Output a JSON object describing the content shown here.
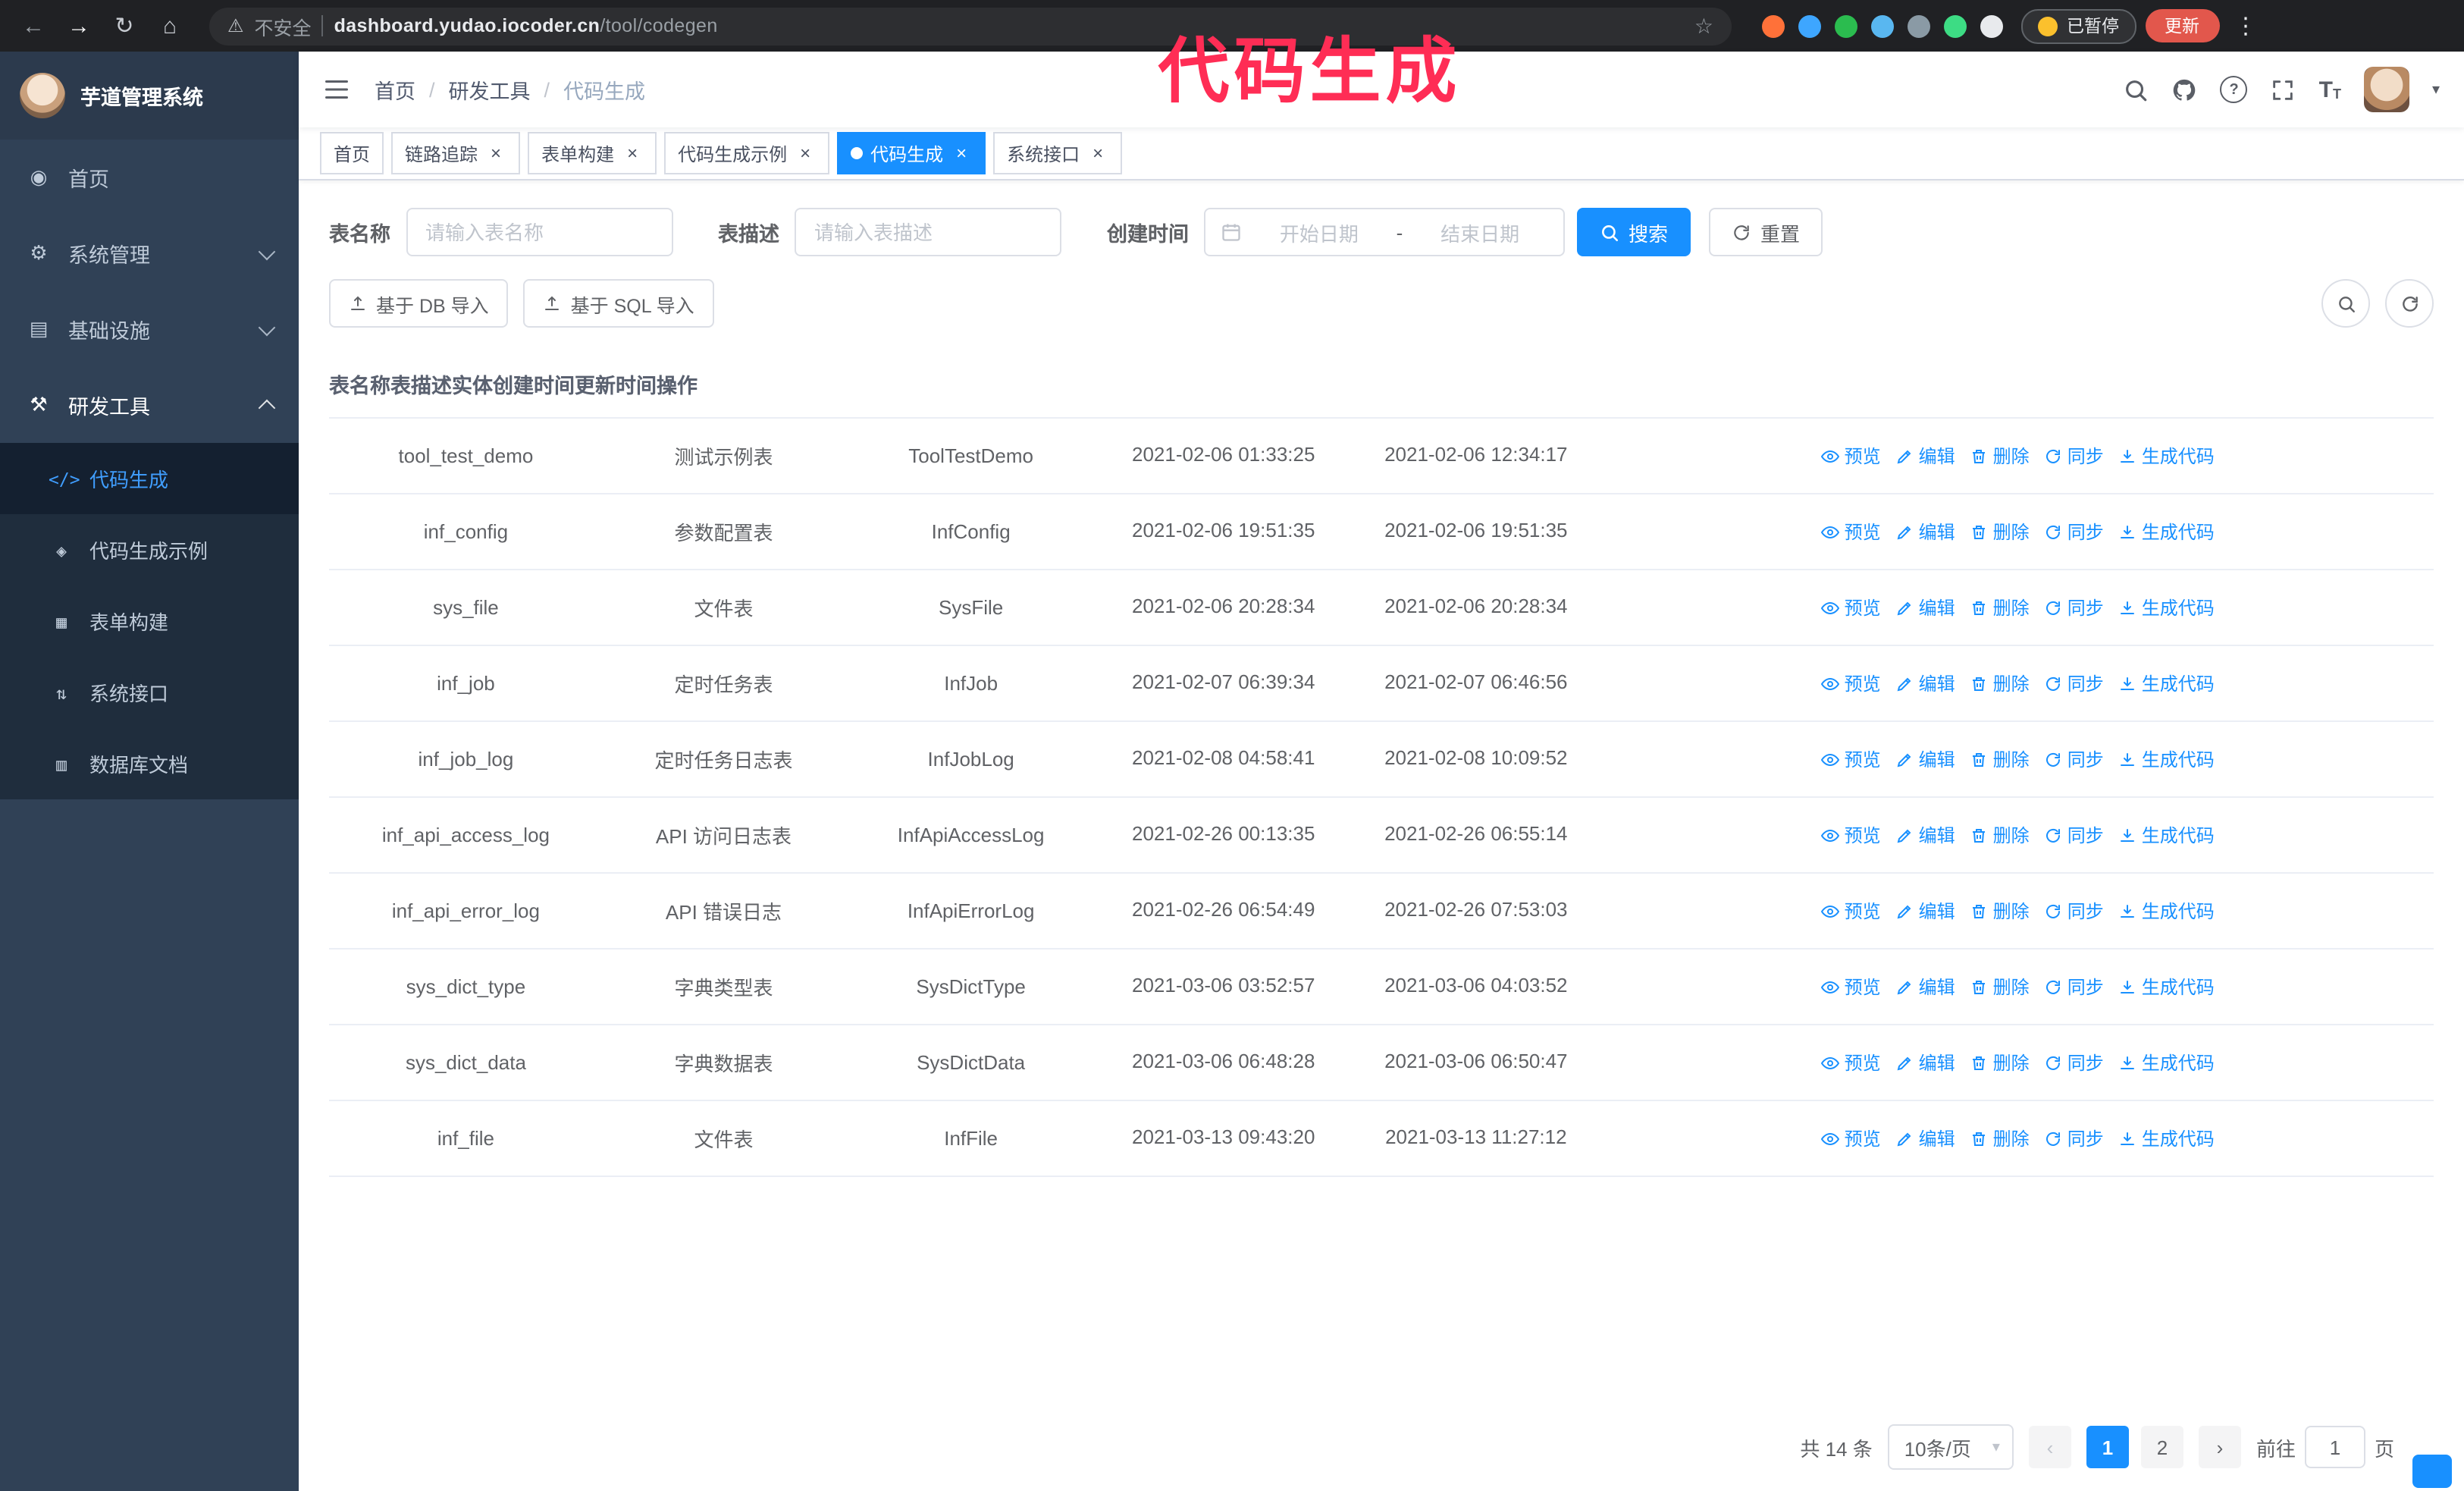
{
  "colors": {
    "primary": "#1890ff",
    "annotation": "#ff2d55",
    "sidebar_bg": "#304156"
  },
  "icons": {
    "back": "←",
    "forward": "→",
    "reload": "↻",
    "home": "⌂",
    "warning": "⚠",
    "star": "☆",
    "dots": "⋮",
    "close": "×",
    "prev": "‹",
    "next": "›",
    "caret": "▾",
    "question": "?",
    "fontsize_large": "T",
    "fontsize_small": "T"
  },
  "browser": {
    "security_label": "不安全",
    "url_host": "dashboard.yudao.iocoder.cn",
    "url_path": "/tool/codegen",
    "paused_badge": "已暂停",
    "update_button": "更新",
    "extensions": [
      {
        "color": "#ff7139"
      },
      {
        "color": "#3ea6ff"
      },
      {
        "color": "#2bbc4f"
      },
      {
        "color": "#59b7f0"
      },
      {
        "color": "#8a9aa5"
      },
      {
        "color": "#3ddc84"
      },
      {
        "color": "#e8eaed"
      }
    ]
  },
  "annotation": {
    "text": "代码生成"
  },
  "sidebar": {
    "logo_title": "芋道管理系统",
    "items": [
      {
        "label": "首页",
        "icon": "dashboard-icon",
        "glyph": "◉"
      },
      {
        "label": "系统管理",
        "icon": "system-icon",
        "glyph": "⚙",
        "chevron_down": true
      },
      {
        "label": "基础设施",
        "icon": "infra-icon",
        "glyph": "▤",
        "chevron_down": true
      },
      {
        "label": "研发工具",
        "icon": "tools-icon",
        "glyph": "⚒",
        "chevron_up": true,
        "expanded": true
      }
    ],
    "subitems": [
      {
        "label": "代码生成",
        "icon": "code-icon",
        "glyph": "</>",
        "active": true
      },
      {
        "label": "代码生成示例",
        "icon": "example-icon",
        "glyph": "◈"
      },
      {
        "label": "表单构建",
        "icon": "form-icon",
        "glyph": "▦"
      },
      {
        "label": "系统接口",
        "icon": "api-icon",
        "glyph": "⇅"
      },
      {
        "label": "数据库文档",
        "icon": "db-doc-icon",
        "glyph": "▥"
      }
    ]
  },
  "header": {
    "breadcrumb": [
      {
        "label": "首页"
      },
      {
        "label": "研发工具"
      },
      {
        "label": "代码生成"
      }
    ],
    "breadcrumb_separator": "/"
  },
  "tabs": [
    {
      "label": "首页",
      "closable": false,
      "active": false
    },
    {
      "label": "链路追踪",
      "closable": true,
      "active": false
    },
    {
      "label": "表单构建",
      "closable": true,
      "active": false
    },
    {
      "label": "代码生成示例",
      "closable": true,
      "active": false
    },
    {
      "label": "代码生成",
      "closable": true,
      "active": true
    },
    {
      "label": "系统接口",
      "closable": true,
      "active": false
    }
  ],
  "filters": {
    "table_name_label": "表名称",
    "table_name_placeholder": "请输入表名称",
    "table_desc_label": "表描述",
    "table_desc_placeholder": "请输入表描述",
    "create_time_label": "创建时间",
    "date_start_placeholder": "开始日期",
    "date_separator": "-",
    "date_end_placeholder": "结束日期",
    "search_button": "搜索",
    "reset_button": "重置"
  },
  "toolbar": {
    "import_db": "基于 DB 导入",
    "import_sql": "基于 SQL 导入"
  },
  "table": {
    "columns": [
      "表名称",
      "表描述",
      "实体",
      "创建时间",
      "更新时间",
      "操作"
    ],
    "actions": [
      "预览",
      "编辑",
      "删除",
      "同步",
      "生成代码"
    ],
    "rows": [
      {
        "name": "tool_test_demo",
        "desc": "测试示例表",
        "entity": "ToolTestDemo",
        "created": "2021-02-06 01:33:25",
        "updated": "2021-02-06 12:34:17"
      },
      {
        "name": "inf_config",
        "desc": "参数配置表",
        "entity": "InfConfig",
        "created": "2021-02-06 19:51:35",
        "updated": "2021-02-06 19:51:35"
      },
      {
        "name": "sys_file",
        "desc": "文件表",
        "entity": "SysFile",
        "created": "2021-02-06 20:28:34",
        "updated": "2021-02-06 20:28:34"
      },
      {
        "name": "inf_job",
        "desc": "定时任务表",
        "entity": "InfJob",
        "created": "2021-02-07 06:39:34",
        "updated": "2021-02-07 06:46:56"
      },
      {
        "name": "inf_job_log",
        "desc": "定时任务日志表",
        "entity": "InfJobLog",
        "created": "2021-02-08 04:58:41",
        "updated": "2021-02-08 10:09:52"
      },
      {
        "name": "inf_api_access_log",
        "desc": "API 访问日志表",
        "entity": "InfApiAccessLog",
        "created": "2021-02-26 00:13:35",
        "updated": "2021-02-26 06:55:14"
      },
      {
        "name": "inf_api_error_log",
        "desc": "API 错误日志",
        "entity": "InfApiErrorLog",
        "created": "2021-02-26 06:54:49",
        "updated": "2021-02-26 07:53:03"
      },
      {
        "name": "sys_dict_type",
        "desc": "字典类型表",
        "entity": "SysDictType",
        "created": "2021-03-06 03:52:57",
        "updated": "2021-03-06 04:03:52"
      },
      {
        "name": "sys_dict_data",
        "desc": "字典数据表",
        "entity": "SysDictData",
        "created": "2021-03-06 06:48:28",
        "updated": "2021-03-06 06:50:47"
      },
      {
        "name": "inf_file",
        "desc": "文件表",
        "entity": "InfFile",
        "created": "2021-03-13 09:43:20",
        "updated": "2021-03-13 11:27:12"
      }
    ]
  },
  "pagination": {
    "total": "共 14 条",
    "page_size": "10条/页",
    "pages": [
      {
        "label": "1",
        "active": true
      },
      {
        "label": "2",
        "active": false
      }
    ],
    "goto_label": "前往",
    "goto_value": "1",
    "goto_suffix": "页"
  }
}
